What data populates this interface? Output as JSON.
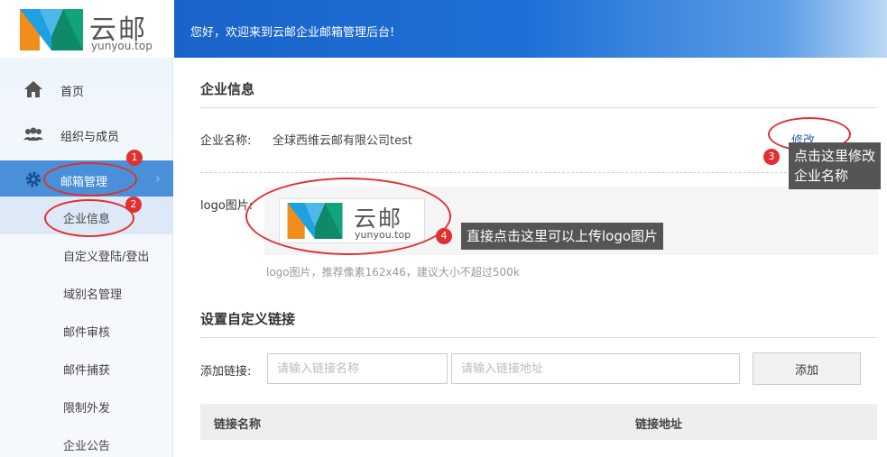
{
  "brand": {
    "name_cn": "云邮",
    "name_en": "yunyou.top"
  },
  "header": {
    "welcome": "您好，欢迎来到云邮企业邮箱管理后台!"
  },
  "sidebar": {
    "items": [
      {
        "label": "首页",
        "icon": "home-icon"
      },
      {
        "label": "组织与成员",
        "icon": "users-icon"
      },
      {
        "label": "邮箱管理",
        "icon": "gear-icon"
      }
    ],
    "sub_items": [
      {
        "label": "企业信息"
      },
      {
        "label": "自定义登陆/登出"
      },
      {
        "label": "域别名管理"
      },
      {
        "label": "邮件审核"
      },
      {
        "label": "邮件捕获"
      },
      {
        "label": "限制外发"
      },
      {
        "label": "企业公告"
      }
    ]
  },
  "company": {
    "section_title": "企业信息",
    "name_label": "企业名称:",
    "name_value": "全球西维云邮有限公司test",
    "edit_link": "修改",
    "logo_label": "logo图片:",
    "logo_hint": "logo图片，推荐像素162x46，建议大小不超过500k"
  },
  "links": {
    "section_title": "设置自定义链接",
    "add_label": "添加链接:",
    "name_placeholder": "请输入链接名称",
    "url_placeholder": "请输入链接地址",
    "add_button": "添加",
    "col_name": "链接名称",
    "col_url": "链接地址"
  },
  "annotations": {
    "badge_1": "1",
    "badge_2": "2",
    "badge_3": "3",
    "badge_4": "4",
    "tip_3_line1": "点击这里修改",
    "tip_3_line2": "企业名称",
    "tip_4": "直接点击这里可以上传logo图片"
  },
  "colors": {
    "accent": "#4a90d9",
    "header": "#1f70d6",
    "annotation": "#e03030"
  }
}
